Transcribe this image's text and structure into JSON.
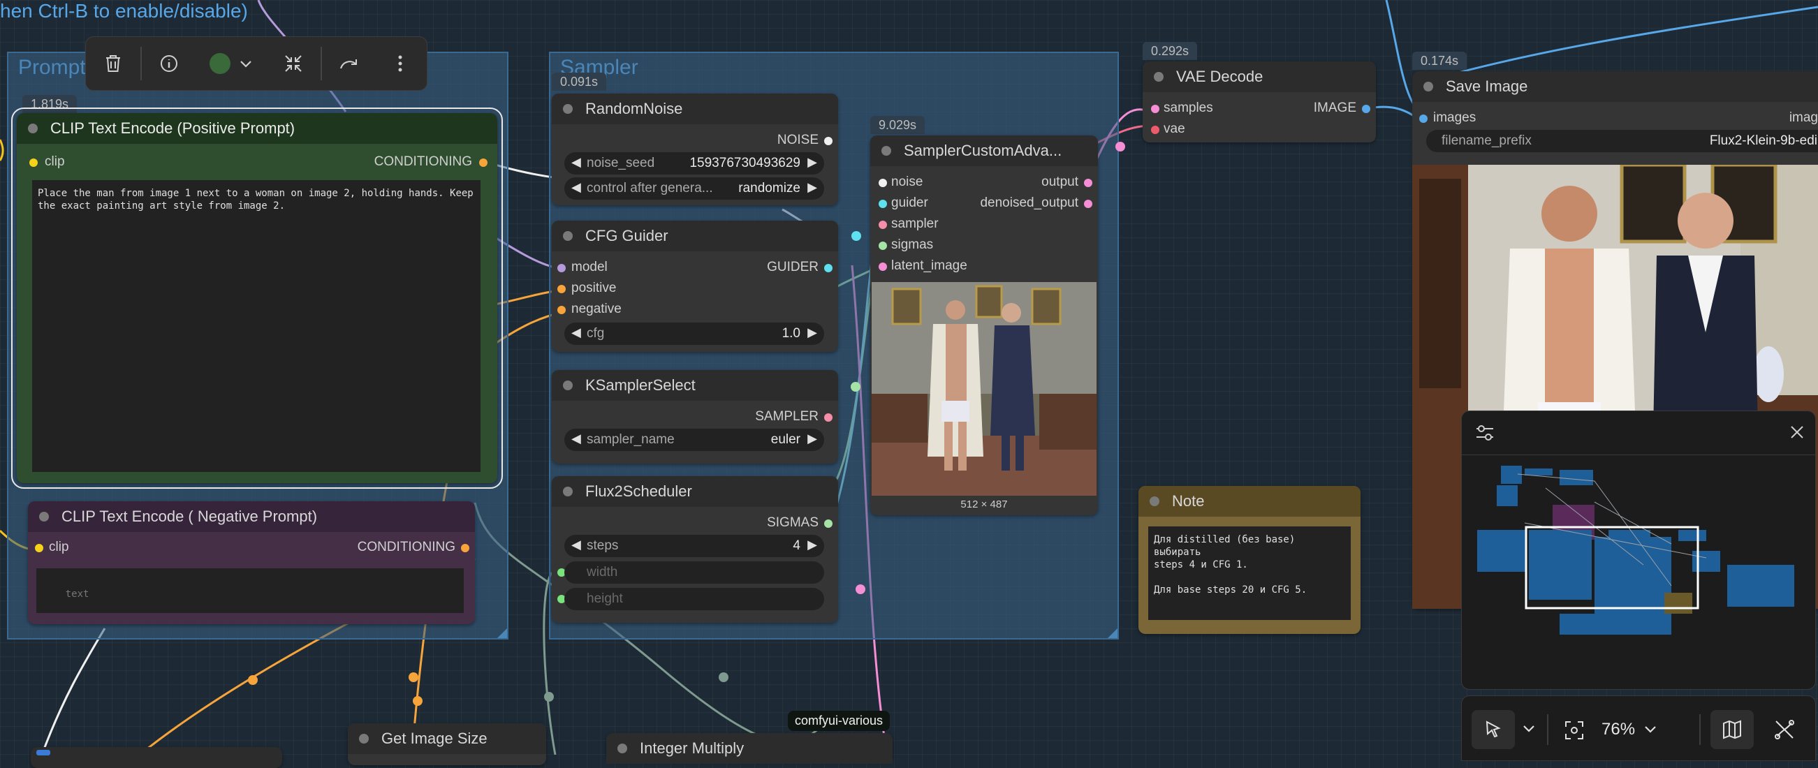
{
  "canvas": {
    "banner_text": "hen Ctrl-B to enable/disable)"
  },
  "groups": {
    "prompt_title": "Prompt",
    "sampler_title": "Sampler"
  },
  "selection_toolbar": {
    "color_value": "#3a6a3a",
    "icons": [
      "trash-icon",
      "info-icon",
      "color-picker",
      "chevron-down-icon",
      "collapse-icon",
      "redo-icon",
      "more-vertical-icon"
    ]
  },
  "nodes": {
    "clip_positive": {
      "timing": "1.819s",
      "title": "CLIP Text Encode (Positive Prompt)",
      "input_clip": "clip",
      "output_conditioning": "CONDITIONING",
      "text": "Place the man from image 1 next to a woman on image 2, holding hands. Keep the exact painting art style from image 2."
    },
    "clip_negative": {
      "title": "CLIP Text Encode ( Negative Prompt)",
      "input_clip": "clip",
      "output_conditioning": "CONDITIONING",
      "placeholder": "text"
    },
    "random_noise": {
      "timing": "0.091s",
      "title": "RandomNoise",
      "output_noise": "NOISE",
      "seed_label": "noise_seed",
      "seed_value": "159376730493629",
      "control_label": "control after genera...",
      "control_value": "randomize"
    },
    "cfg_guider": {
      "title": "CFG Guider",
      "input_model": "model",
      "input_positive": "positive",
      "input_negative": "negative",
      "output_guider": "GUIDER",
      "cfg_label": "cfg",
      "cfg_value": "1.0"
    },
    "ksampler_select": {
      "title": "KSamplerSelect",
      "output_sampler": "SAMPLER",
      "sampler_label": "sampler_name",
      "sampler_value": "euler"
    },
    "flux2_scheduler": {
      "title": "Flux2Scheduler",
      "output_sigmas": "SIGMAS",
      "steps_label": "steps",
      "steps_value": "4",
      "width_label": "width",
      "height_label": "height"
    },
    "sampler_custom": {
      "timing": "9.029s",
      "title": "SamplerCustomAdva...",
      "input_noise": "noise",
      "input_guider": "guider",
      "input_sampler": "sampler",
      "input_sigmas": "sigmas",
      "input_latent": "latent_image",
      "output_output": "output",
      "output_denoised": "denoised_output",
      "preview_size": "512 × 487"
    },
    "vae_decode": {
      "timing": "0.292s",
      "title": "VAE Decode",
      "input_samples": "samples",
      "input_vae": "vae",
      "output_image": "IMAGE"
    },
    "save_image": {
      "timing": "0.174s",
      "title": "Save Image",
      "input_images": "images",
      "output_images": "imag",
      "prefix_label": "filename_prefix",
      "prefix_value": "Flux2-Klein-9b-edi"
    },
    "note": {
      "title": "Note",
      "text": "Для distilled (без base) выбирать\nsteps 4 и CFG 1.\n\nДля base steps 20 и CFG 5."
    },
    "get_image_size": {
      "title": "Get Image Size"
    },
    "integer_multiply": {
      "title": "Integer Multiply"
    }
  },
  "badge": {
    "text": "comfyui-various"
  },
  "minimap": {
    "settings_icon": "sliders-icon",
    "close_icon": "close-icon"
  },
  "bottom_toolbar": {
    "zoom": "76%",
    "icons": [
      "pointer-icon",
      "chevron-down-icon",
      "fit-view-icon",
      "chevron-down-icon",
      "map-icon",
      "link-visibility-icon"
    ]
  }
}
